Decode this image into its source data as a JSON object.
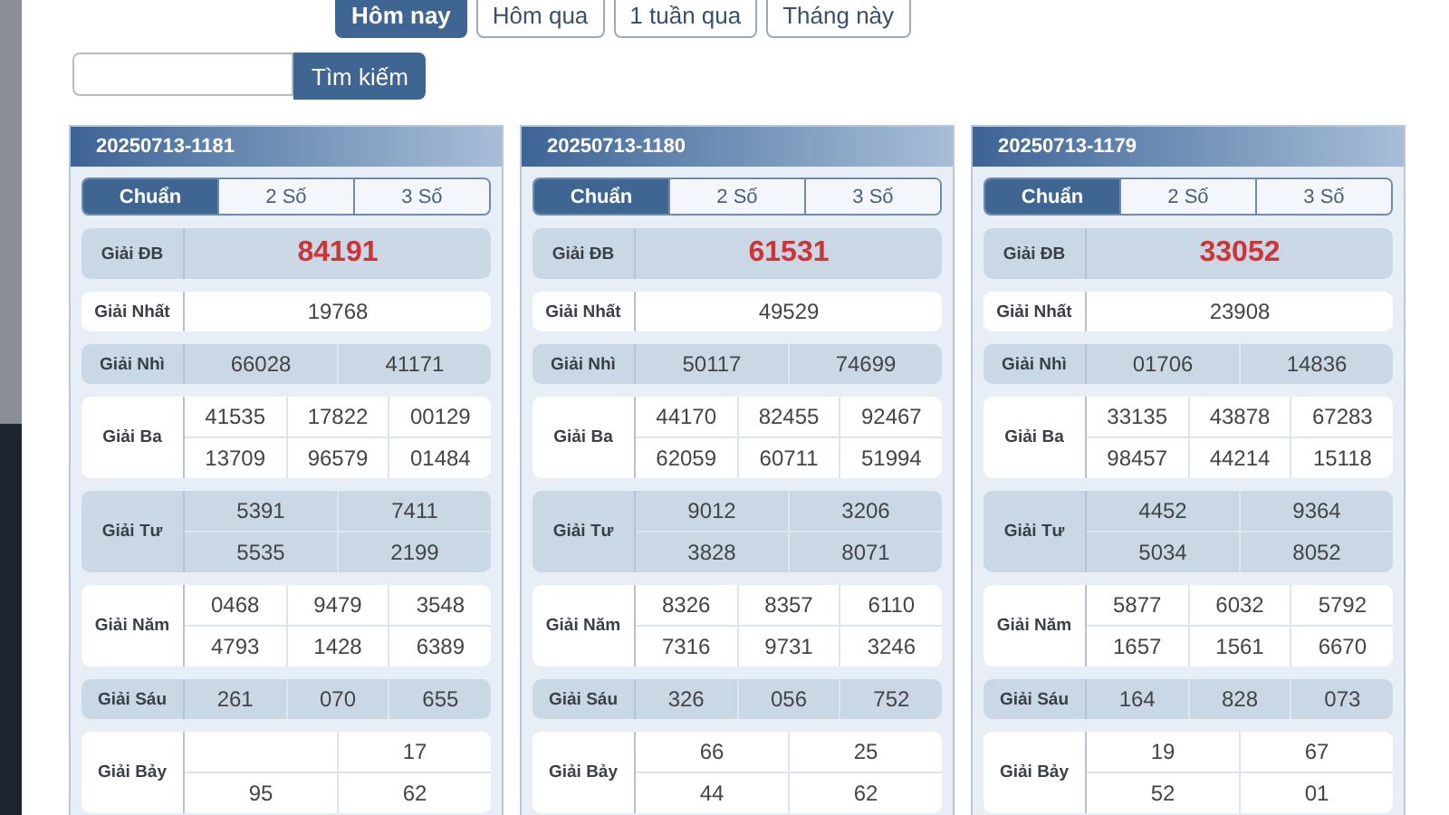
{
  "filters": [
    {
      "label": "Hôm nay",
      "selected": true
    },
    {
      "label": "Hôm qua",
      "selected": false
    },
    {
      "label": "1 tuần qua",
      "selected": false
    },
    {
      "label": "Tháng này",
      "selected": false
    }
  ],
  "search": {
    "button": "Tìm kiếm"
  },
  "cards": [
    {
      "title": "20250713-1181",
      "tabs": [
        {
          "label": "Chuẩn",
          "selected": true
        },
        {
          "label": "2 Số",
          "selected": false
        },
        {
          "label": "3 Số",
          "selected": false
        }
      ],
      "prizes": [
        {
          "label": "Giải ĐB",
          "kind": "special",
          "rows": [
            [
              "84191"
            ]
          ]
        },
        {
          "label": "Giải Nhất",
          "kind": "normal",
          "rows": [
            [
              "19768"
            ]
          ]
        },
        {
          "label": "Giải Nhì",
          "kind": "normal",
          "rows": [
            [
              "66028",
              "41171"
            ]
          ]
        },
        {
          "label": "Giải Ba",
          "kind": "normal",
          "rows": [
            [
              "41535",
              "17822",
              "00129"
            ],
            [
              "13709",
              "96579",
              "01484"
            ]
          ]
        },
        {
          "label": "Giải Tư",
          "kind": "normal",
          "rows": [
            [
              "5391",
              "7411"
            ],
            [
              "5535",
              "2199"
            ]
          ]
        },
        {
          "label": "Giải Năm",
          "kind": "normal",
          "rows": [
            [
              "0468",
              "9479",
              "3548"
            ],
            [
              "4793",
              "1428",
              "6389"
            ]
          ]
        },
        {
          "label": "Giải Sáu",
          "kind": "normal",
          "rows": [
            [
              "261",
              "070",
              "655"
            ]
          ]
        },
        {
          "label": "Giải Bảy",
          "kind": "normal",
          "rows": [
            [
              null,
              "17"
            ],
            [
              "95",
              "62"
            ]
          ]
        }
      ]
    },
    {
      "title": "20250713-1180",
      "tabs": [
        {
          "label": "Chuẩn",
          "selected": true
        },
        {
          "label": "2 Số",
          "selected": false
        },
        {
          "label": "3 Số",
          "selected": false
        }
      ],
      "prizes": [
        {
          "label": "Giải ĐB",
          "kind": "special",
          "rows": [
            [
              "61531"
            ]
          ]
        },
        {
          "label": "Giải Nhất",
          "kind": "normal",
          "rows": [
            [
              "49529"
            ]
          ]
        },
        {
          "label": "Giải Nhì",
          "kind": "normal",
          "rows": [
            [
              "50117",
              "74699"
            ]
          ]
        },
        {
          "label": "Giải Ba",
          "kind": "normal",
          "rows": [
            [
              "44170",
              "82455",
              "92467"
            ],
            [
              "62059",
              "60711",
              "51994"
            ]
          ]
        },
        {
          "label": "Giải Tư",
          "kind": "normal",
          "rows": [
            [
              "9012",
              "3206"
            ],
            [
              "3828",
              "8071"
            ]
          ]
        },
        {
          "label": "Giải Năm",
          "kind": "normal",
          "rows": [
            [
              "8326",
              "8357",
              "6110"
            ],
            [
              "7316",
              "9731",
              "3246"
            ]
          ]
        },
        {
          "label": "Giải Sáu",
          "kind": "normal",
          "rows": [
            [
              "326",
              "056",
              "752"
            ]
          ]
        },
        {
          "label": "Giải Bảy",
          "kind": "normal",
          "rows": [
            [
              "66",
              "25"
            ],
            [
              "44",
              "62"
            ]
          ]
        }
      ]
    },
    {
      "title": "20250713-1179",
      "tabs": [
        {
          "label": "Chuẩn",
          "selected": true
        },
        {
          "label": "2 Số",
          "selected": false
        },
        {
          "label": "3 Số",
          "selected": false
        }
      ],
      "prizes": [
        {
          "label": "Giải ĐB",
          "kind": "special",
          "rows": [
            [
              "33052"
            ]
          ]
        },
        {
          "label": "Giải Nhất",
          "kind": "normal",
          "rows": [
            [
              "23908"
            ]
          ]
        },
        {
          "label": "Giải Nhì",
          "kind": "normal",
          "rows": [
            [
              "01706",
              "14836"
            ]
          ]
        },
        {
          "label": "Giải Ba",
          "kind": "normal",
          "rows": [
            [
              "33135",
              "43878",
              "67283"
            ],
            [
              "98457",
              "44214",
              "15118"
            ]
          ]
        },
        {
          "label": "Giải Tư",
          "kind": "normal",
          "rows": [
            [
              "4452",
              "9364"
            ],
            [
              "5034",
              "8052"
            ]
          ]
        },
        {
          "label": "Giải Năm",
          "kind": "normal",
          "rows": [
            [
              "5877",
              "6032",
              "5792"
            ],
            [
              "1657",
              "1561",
              "6670"
            ]
          ]
        },
        {
          "label": "Giải Sáu",
          "kind": "normal",
          "rows": [
            [
              "164",
              "828",
              "073"
            ]
          ]
        },
        {
          "label": "Giải Bảy",
          "kind": "normal",
          "rows": [
            [
              "19",
              "67"
            ],
            [
              "52",
              "01"
            ]
          ]
        }
      ]
    }
  ]
}
